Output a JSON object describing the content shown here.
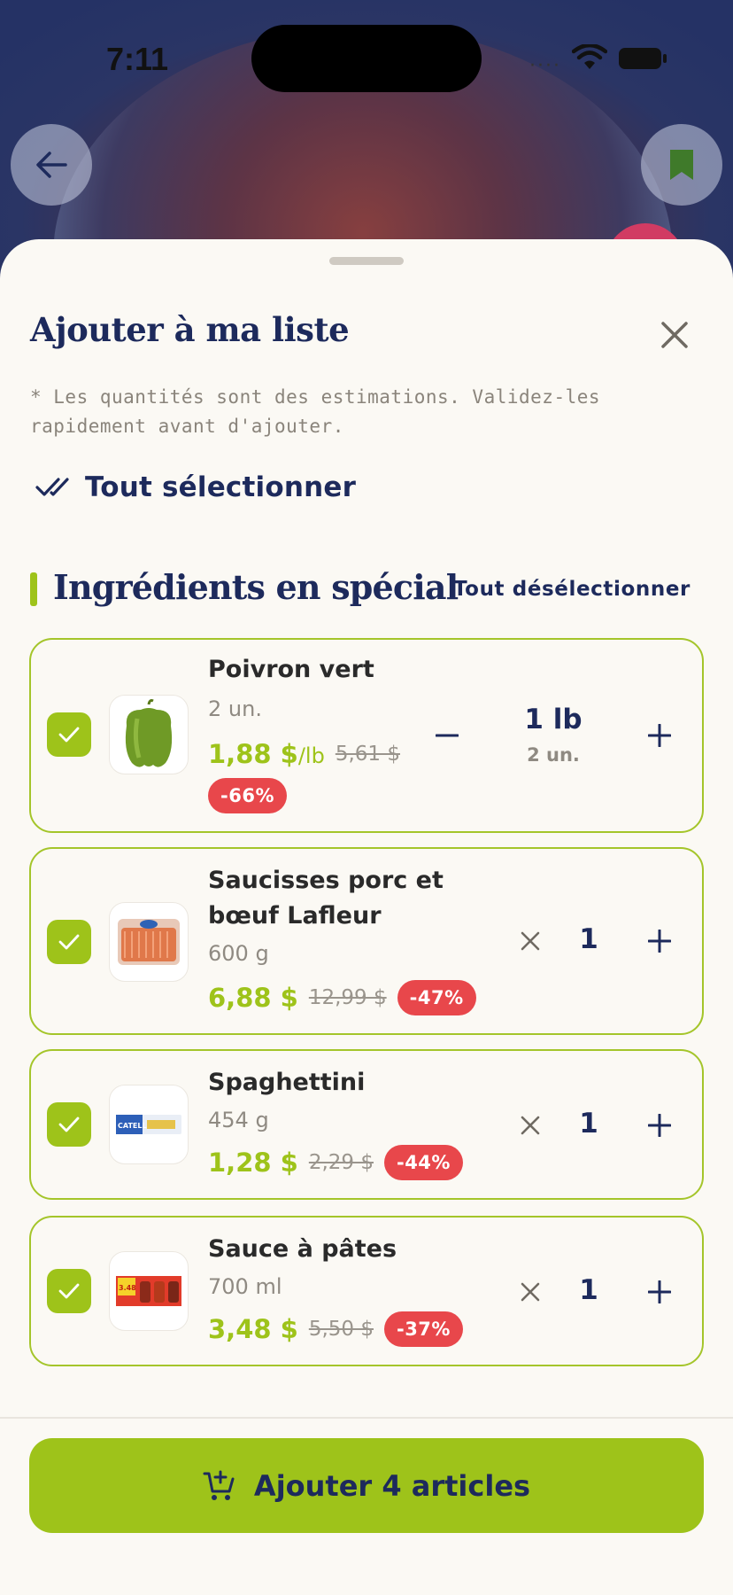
{
  "status_bar": {
    "time": "7:11"
  },
  "sheet": {
    "title": "Ajouter à ma liste",
    "note": "* Les quantités sont des estimations. Validez-les rapidement avant d'ajouter.",
    "select_all_label": "Tout sélectionner",
    "section_title": "Ingrédients en spécial",
    "deselect_all_label": "Tout désélectionner"
  },
  "items": [
    {
      "name": "Poivron vert",
      "size": "2 un.",
      "price": "1,88 $",
      "price_unit": "/lb",
      "old_price": "5,61 $",
      "discount": "-66%",
      "qty": "1 lb",
      "qty_sub": "2 un.",
      "checked": true
    },
    {
      "name_line1": "Saucisses porc et",
      "name_line2": "bœuf Lafleur",
      "size": "600 g",
      "price": "6,88 $",
      "old_price": "12,99 $",
      "discount": "-47%",
      "qty": "1",
      "checked": true
    },
    {
      "name": "Spaghettini",
      "size": "454 g",
      "price": "1,28 $",
      "old_price": "2,29 $",
      "discount": "-44%",
      "qty": "1",
      "checked": true
    },
    {
      "name": "Sauce à pâtes",
      "size": "700 ml",
      "price": "3,48 $",
      "old_price": "5,50 $",
      "discount": "-37%",
      "qty": "1",
      "checked": true
    }
  ],
  "thumb_texts": {
    "spaghetti_brand": "CATELLI",
    "sauce_price": "3.48"
  },
  "cta": {
    "label": "Ajouter 4 articles"
  },
  "colors": {
    "accent_green": "#9ec31a",
    "navy": "#1d2a5c",
    "discount_red": "#e8474b"
  },
  "icons": [
    "back-arrow-icon",
    "bookmark-icon",
    "close-icon",
    "double-check-icon",
    "checkmark-icon",
    "minus-icon",
    "plus-icon",
    "remove-x-icon",
    "cart-add-icon",
    "wifi-icon",
    "battery-icon"
  ]
}
